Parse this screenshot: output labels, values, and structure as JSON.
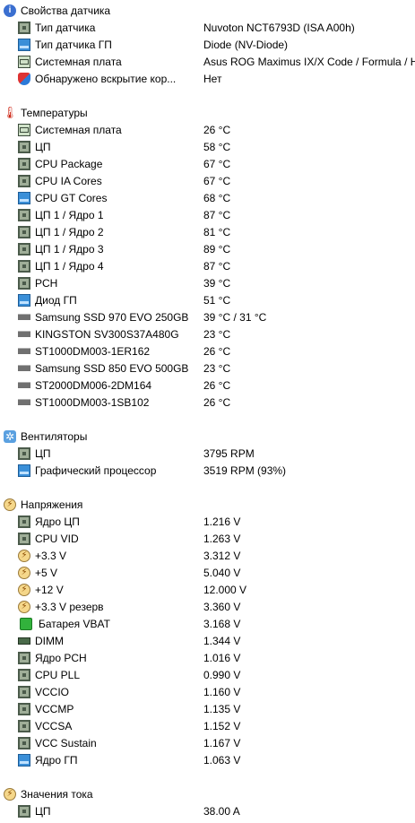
{
  "sections": {
    "sensor_properties": {
      "title": "Свойства датчика",
      "items": [
        {
          "label": "Тип датчика",
          "value": "Nuvoton NCT6793D  (ISA A00h)",
          "icon": "chip-icon"
        },
        {
          "label": "Тип датчика ГП",
          "value": "Diode  (NV-Diode)",
          "icon": "gpu-icon"
        },
        {
          "label": "Системная плата",
          "value": "Asus ROG Maximus IX/X Code / Formula / Hero",
          "icon": "motherboard-icon"
        },
        {
          "label": "Обнаружено вскрытие кор...",
          "value": "Нет",
          "icon": "shield-icon"
        }
      ]
    },
    "temperatures": {
      "title": "Температуры",
      "items": [
        {
          "label": "Системная плата",
          "value": "26 °C",
          "icon": "motherboard-icon"
        },
        {
          "label": "ЦП",
          "value": "58 °C",
          "icon": "chip-icon"
        },
        {
          "label": "CPU Package",
          "value": "67 °C",
          "icon": "chip-icon"
        },
        {
          "label": "CPU IA Cores",
          "value": "67 °C",
          "icon": "chip-icon"
        },
        {
          "label": "CPU GT Cores",
          "value": "68 °C",
          "icon": "gpu-icon"
        },
        {
          "label": "ЦП 1 / Ядро 1",
          "value": "87 °C",
          "icon": "chip-icon"
        },
        {
          "label": "ЦП 1 / Ядро 2",
          "value": "81 °C",
          "icon": "chip-icon"
        },
        {
          "label": "ЦП 1 / Ядро 3",
          "value": "89 °C",
          "icon": "chip-icon"
        },
        {
          "label": "ЦП 1 / Ядро 4",
          "value": "87 °C",
          "icon": "chip-icon"
        },
        {
          "label": "PCH",
          "value": "39 °C",
          "icon": "chip-icon"
        },
        {
          "label": "Диод ГП",
          "value": "51 °C",
          "icon": "gpu-icon"
        },
        {
          "label": "Samsung SSD 970 EVO 250GB",
          "value": "39 °C / 31 °C",
          "icon": "drive-icon"
        },
        {
          "label": "KINGSTON SV300S37A480G",
          "value": "23 °C",
          "icon": "drive-icon"
        },
        {
          "label": "ST1000DM003-1ER162",
          "value": "26 °C",
          "icon": "drive-icon"
        },
        {
          "label": "Samsung SSD 850 EVO 500GB",
          "value": "23 °C",
          "icon": "drive-icon"
        },
        {
          "label": "ST2000DM006-2DM164",
          "value": "26 °C",
          "icon": "drive-icon"
        },
        {
          "label": "ST1000DM003-1SB102",
          "value": "26 °C",
          "icon": "drive-icon"
        }
      ]
    },
    "fans": {
      "title": "Вентиляторы",
      "items": [
        {
          "label": "ЦП",
          "value": "3795 RPM",
          "icon": "chip-icon"
        },
        {
          "label": "Графический процессор",
          "value": "3519 RPM  (93%)",
          "icon": "gpu-icon"
        }
      ]
    },
    "voltages": {
      "title": "Напряжения",
      "items": [
        {
          "label": "Ядро ЦП",
          "value": "1.216 V",
          "icon": "chip-icon"
        },
        {
          "label": "CPU VID",
          "value": "1.263 V",
          "icon": "chip-icon"
        },
        {
          "label": "+3.3 V",
          "value": "3.312 V",
          "icon": "voltage-icon"
        },
        {
          "label": "+5 V",
          "value": "5.040 V",
          "icon": "voltage-icon"
        },
        {
          "label": "+12 V",
          "value": "12.000 V",
          "icon": "voltage-icon"
        },
        {
          "label": "+3.3 V резерв",
          "value": "3.360 V",
          "icon": "voltage-icon"
        },
        {
          "label": "Батарея VBAT",
          "value": "3.168 V",
          "icon": "battery-icon"
        },
        {
          "label": "DIMM",
          "value": "1.344 V",
          "icon": "dimm-icon"
        },
        {
          "label": "Ядро PCH",
          "value": "1.016 V",
          "icon": "chip-icon"
        },
        {
          "label": "CPU PLL",
          "value": "0.990 V",
          "icon": "chip-icon"
        },
        {
          "label": "VCCIO",
          "value": "1.160 V",
          "icon": "chip-icon"
        },
        {
          "label": "VCCMP",
          "value": "1.135 V",
          "icon": "chip-icon"
        },
        {
          "label": "VCCSA",
          "value": "1.152 V",
          "icon": "chip-icon"
        },
        {
          "label": "VCC Sustain",
          "value": "1.167 V",
          "icon": "chip-icon"
        },
        {
          "label": "Ядро ГП",
          "value": "1.063 V",
          "icon": "gpu-icon"
        }
      ]
    },
    "currents": {
      "title": "Значения тока",
      "items": [
        {
          "label": "ЦП",
          "value": "38.00 A",
          "icon": "chip-icon"
        }
      ]
    }
  },
  "header_icons": {
    "sensor_properties": "info-icon",
    "temperatures": "thermometer-icon",
    "fans": "fan-icon",
    "voltages": "voltage-icon",
    "currents": "current-icon"
  }
}
